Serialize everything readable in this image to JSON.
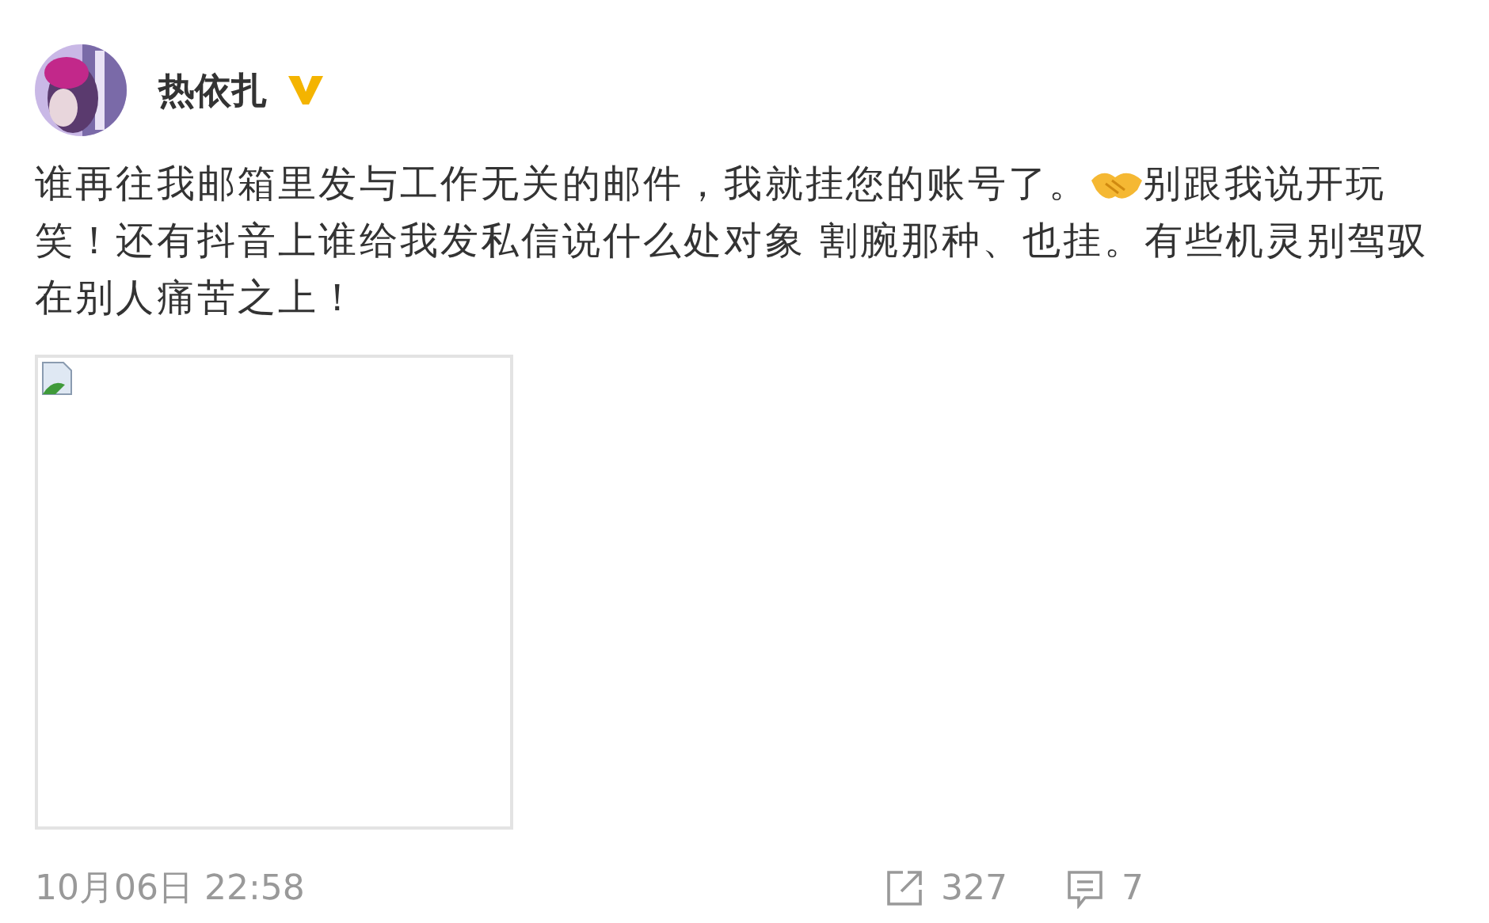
{
  "author": {
    "name": "热依扎",
    "verified": true
  },
  "post": {
    "lines": [
      [
        {
          "kind": "text",
          "text": "谁再往我邮箱里发与工作无关的邮件，我就挂您的账号了。"
        },
        {
          "kind": "emoji"
        },
        {
          "kind": "text",
          "text": "别跟我说开玩"
        }
      ],
      [
        {
          "kind": "text",
          "text": "笑！还有抖音上谁给我发私信说什么处对象 割腕那种、也挂。有些机灵别驾驭"
        }
      ],
      [
        {
          "kind": "text",
          "text": "在别人痛苦之上！"
        }
      ]
    ]
  },
  "attachment": {
    "kind": "broken-image"
  },
  "footer": {
    "time": "10月06日 22:58",
    "reposts": "327",
    "comments": "7"
  }
}
